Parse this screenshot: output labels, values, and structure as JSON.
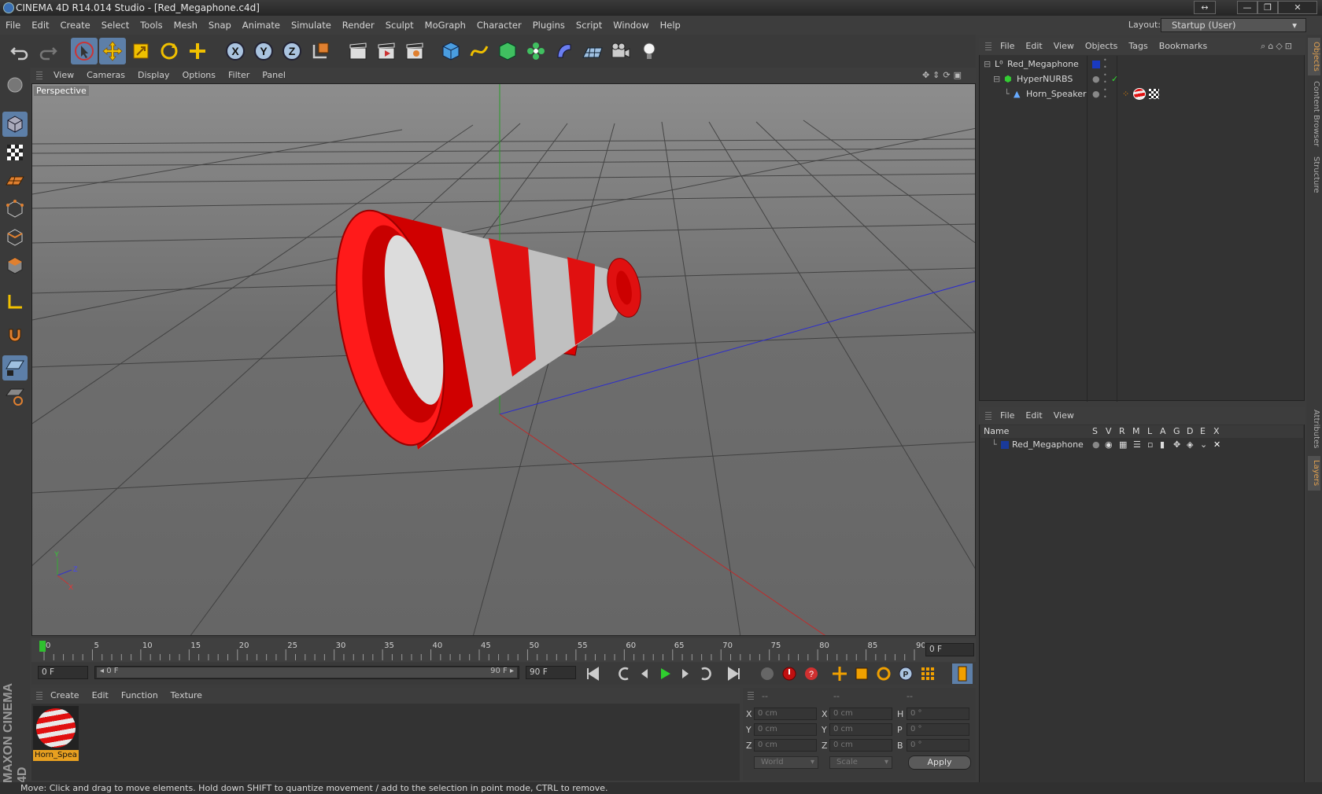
{
  "window": {
    "title": "CINEMA 4D R14.014 Studio - [Red_Megaphone.c4d]",
    "controls": [
      "↔",
      "—",
      "❐",
      "✕"
    ]
  },
  "menubar": {
    "items": [
      "File",
      "Edit",
      "Create",
      "Select",
      "Tools",
      "Mesh",
      "Snap",
      "Animate",
      "Simulate",
      "Render",
      "Sculpt",
      "MoGraph",
      "Character",
      "Plugins",
      "Script",
      "Window",
      "Help"
    ],
    "layout_label": "Layout:",
    "layout_value": "Startup (User)"
  },
  "viewport": {
    "menu": [
      "View",
      "Cameras",
      "Display",
      "Options",
      "Filter",
      "Panel"
    ],
    "label": "Perspective",
    "axis": {
      "x": "X",
      "y": "Y",
      "z": "Z"
    }
  },
  "timeline": {
    "ticks": [
      "0",
      "5",
      "10",
      "15",
      "20",
      "25",
      "30",
      "35",
      "40",
      "45",
      "50",
      "55",
      "60",
      "65",
      "70",
      "75",
      "80",
      "85",
      "90"
    ],
    "current_frame": "0 F",
    "start_field": "0 F",
    "range_start": "◂ 0 F",
    "range_end": "90 F ▸",
    "end_field": "90 F",
    "progress": 0.0
  },
  "material_panel": {
    "menu": [
      "Create",
      "Edit",
      "Function",
      "Texture"
    ],
    "material_name": "Horn_Spea"
  },
  "coord_panel": {
    "headers": [
      "--",
      "--",
      "--"
    ],
    "rows": [
      {
        "l1": "X",
        "v1": "0 cm",
        "l2": "X",
        "v2": "0 cm",
        "l3": "H",
        "v3": "0 °"
      },
      {
        "l1": "Y",
        "v1": "0 cm",
        "l2": "Y",
        "v2": "0 cm",
        "l3": "P",
        "v3": "0 °"
      },
      {
        "l1": "Z",
        "v1": "0 cm",
        "l2": "Z",
        "v2": "0 cm",
        "l3": "B",
        "v3": "0 °"
      }
    ],
    "mode_world": "World",
    "mode_scale": "Scale",
    "apply": "Apply"
  },
  "objects_panel": {
    "menu": [
      "File",
      "Edit",
      "View",
      "Objects",
      "Tags",
      "Bookmarks"
    ],
    "items": [
      {
        "name": "Red_Megaphone",
        "depth": 0
      },
      {
        "name": "HyperNURBS",
        "depth": 1
      },
      {
        "name": "Horn_Speaker",
        "depth": 2
      }
    ]
  },
  "layers_panel": {
    "menu": [
      "File",
      "Edit",
      "View"
    ],
    "columns": [
      "Name",
      "S",
      "V",
      "R",
      "M",
      "L",
      "A",
      "G",
      "D",
      "E",
      "X"
    ],
    "items": [
      {
        "name": "Red_Megaphone",
        "color": "#1a3a9a"
      }
    ]
  },
  "right_tabs": [
    "Objects",
    "Content Browser",
    "Structure",
    "Attributes",
    "Layers"
  ],
  "branding": "MAXON CINEMA 4D",
  "statusbar": "Move: Click and drag to move elements. Hold down SHIFT to quantize movement / add to the selection in point mode, CTRL to remove.",
  "colors": {
    "accent": "#5d7fa8",
    "megaphone_red": "#e01010",
    "grid_x": "#c03030",
    "grid_z": "#3030c0",
    "grid_y": "#30a030"
  }
}
